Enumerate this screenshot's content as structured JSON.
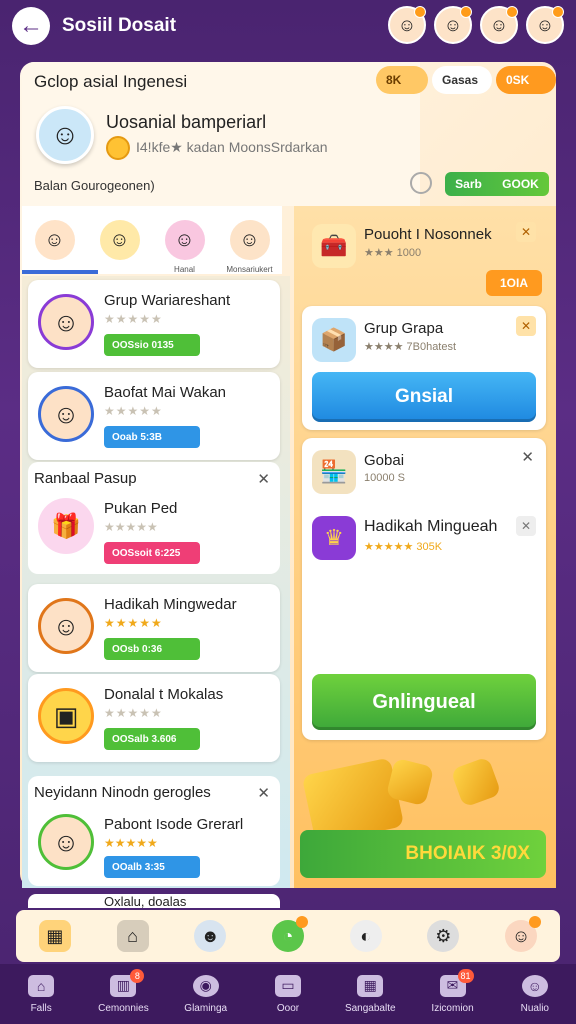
{
  "header": {
    "title": "Sosiil Dosait"
  },
  "top_avatars": [
    "avatar-1",
    "avatar-2",
    "avatar-3",
    "avatar-4"
  ],
  "group_card": {
    "title": "Gclop asial Ingenesi",
    "name": "Uosanial bamperiarl",
    "subtitle": "I4!kfe★ kadan MoonsSrdarkan",
    "footer": "Balan Gourogeonen)",
    "badges": [
      "8K",
      "Gasas",
      "0SK"
    ],
    "green_pill": [
      "Sarb",
      "GOOK"
    ]
  },
  "tabs": [
    {
      "label": ""
    },
    {
      "label": ""
    },
    {
      "label": "Hanal"
    },
    {
      "label": "Monsariukert"
    }
  ],
  "left_cards": [
    {
      "title": "Grup Wariareshant",
      "cta": "OOSsio 0135",
      "cta_color": "green",
      "stars_gold": false
    },
    {
      "title": "Baofat Mai Wakan",
      "cta": "Ooab 5:3B",
      "cta_color": "blue",
      "stars_gold": false
    }
  ],
  "section1": {
    "title": "Ranbaal Pasup",
    "card": {
      "title": "Pukan Ped",
      "cta": "OOSsoit 6:225",
      "cta_color": "pink"
    }
  },
  "left_cards2": [
    {
      "title": "Hadikah Mingwedar",
      "cta": "OOsb 0:36",
      "cta_color": "green",
      "stars_gold": true
    },
    {
      "title": "Donalal t Mokalas",
      "cta": "OOSalb 3.606",
      "cta_color": "green",
      "stars_gold": false
    }
  ],
  "section2": {
    "title": "Neyidann Ninodn gerogles",
    "card": {
      "title": "Pabont Isode Grerarl",
      "cta": "OOalb 3:35",
      "cta_color": "blue"
    }
  },
  "section3_title": "Oxlalu, doalas",
  "right": {
    "card1": {
      "title": "Pouoht I Nosonnek",
      "sub": "★★★ 1000"
    },
    "orange_label": "1OIA",
    "card2": {
      "title": "Grup Grapa",
      "sub": "★★★★ 7B0hatest",
      "button": "Gnsial"
    },
    "card3": {
      "title": "Gobai",
      "sub": "10000 S"
    },
    "card4": {
      "title": "Hadikah Mingueah",
      "sub": "★★★★★ 305K",
      "button": "Gnlingueal"
    },
    "promo": "BHOIAIK 3/0X"
  },
  "quick_bar": [
    "box-icon",
    "house-icon",
    "face-icon",
    "chat-icon",
    "circle-icon",
    "gear-icon",
    "person-icon"
  ],
  "bottom_nav": [
    {
      "label": "Falls",
      "badge": ""
    },
    {
      "label": "Cemonnies",
      "badge": "8"
    },
    {
      "label": "Glaminga",
      "badge": ""
    },
    {
      "label": "Ooor",
      "badge": ""
    },
    {
      "label": "Sangabalte",
      "badge": ""
    },
    {
      "label": "Izicomion",
      "badge": "81"
    },
    {
      "label": "Nualio",
      "badge": ""
    }
  ]
}
